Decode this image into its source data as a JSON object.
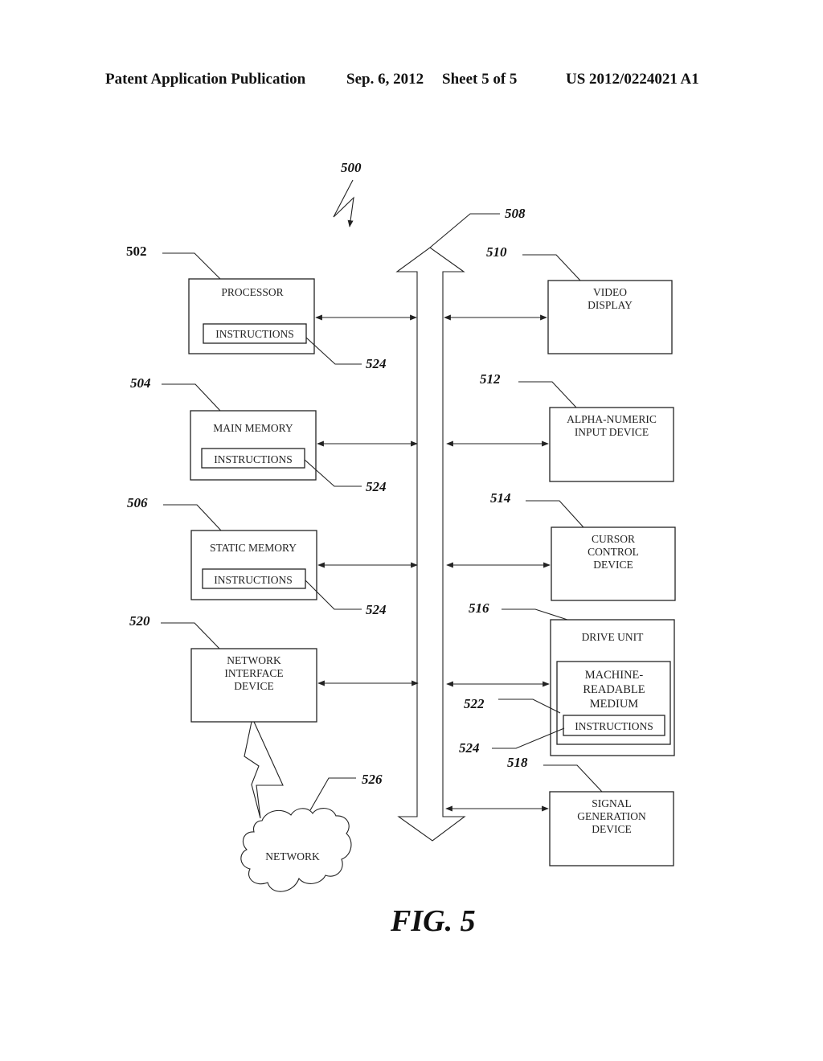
{
  "header": {
    "publication": "Patent Application Publication",
    "date": "Sep. 6, 2012",
    "sheet": "Sheet 5 of 5",
    "number": "US 2012/0224021 A1"
  },
  "figure": {
    "caption": "FIG. 5",
    "system_ref": "500",
    "bus_ref": "508"
  },
  "left_components": [
    {
      "ref": "502",
      "lines": [
        "PROCESSOR"
      ],
      "instructions": "INSTRUCTIONS",
      "instructions_ref": "524"
    },
    {
      "ref": "504",
      "lines": [
        "MAIN MEMORY"
      ],
      "instructions": "INSTRUCTIONS",
      "instructions_ref": "524"
    },
    {
      "ref": "506",
      "lines": [
        "STATIC MEMORY"
      ],
      "instructions": "INSTRUCTIONS",
      "instructions_ref": "524"
    },
    {
      "ref": "520",
      "lines": [
        "NETWORK",
        "INTERFACE",
        "DEVICE"
      ]
    }
  ],
  "right_components": [
    {
      "ref": "510",
      "lines": [
        "VIDEO",
        "DISPLAY"
      ]
    },
    {
      "ref": "512",
      "lines": [
        "ALPHA-NUMERIC",
        "INPUT DEVICE"
      ]
    },
    {
      "ref": "514",
      "lines": [
        "CURSOR",
        "CONTROL",
        "DEVICE"
      ]
    },
    {
      "ref": "516",
      "lines": [
        "DRIVE UNIT"
      ],
      "medium": {
        "ref": "522",
        "lines": [
          "MACHINE-",
          "READABLE",
          "MEDIUM"
        ],
        "instructions": "INSTRUCTIONS",
        "instructions_ref": "524"
      }
    },
    {
      "ref": "518",
      "lines": [
        "SIGNAL",
        "GENERATION",
        "DEVICE"
      ]
    }
  ],
  "network": {
    "ref": "526",
    "label": "NETWORK"
  }
}
